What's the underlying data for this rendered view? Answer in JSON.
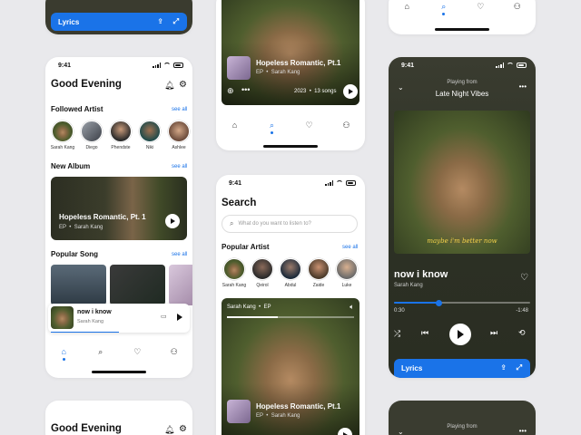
{
  "status_time": "9:41",
  "colors": {
    "accent": "#1a73e8",
    "dark_bg": "#2f3026",
    "page_bg": "#e9e9ec"
  },
  "home": {
    "title": "Good Evening",
    "followed_title": "Followed Artist",
    "see_all": "see all",
    "artists": [
      "Sarah Kang",
      "Diego",
      "Phendste",
      "Niki",
      "Ashlee"
    ],
    "new_album_title": "New Album",
    "album": {
      "title": "Hopeless Romantic, Pt. 1",
      "type": "EP",
      "artist": "Sarah Kang"
    },
    "popular_song_title": "Popular Song",
    "mini_player": {
      "title": "now i know",
      "artist": "Sarah Kang"
    }
  },
  "album_detail": {
    "title": "Hopeless Romantic, Pt.1",
    "type": "EP",
    "artist": "Sarah Kang",
    "year": "2023",
    "songs": "13 songs"
  },
  "search": {
    "title": "Search",
    "placeholder": "What do you want to listen to?",
    "popular_artist_title": "Popular Artist",
    "see_all": "see all",
    "artists": [
      "Sarah Kang",
      "Qeirol",
      "Abdul",
      "Zaide",
      "Luke"
    ],
    "card": {
      "artist": "Sarah Kang",
      "type": "EP",
      "title": "Hopeless Romantic, Pt.1"
    }
  },
  "player": {
    "playing_from": "Playing from",
    "playlist": "Late Night Vibes",
    "cover_caption": "maybe i'm better now",
    "song": "now i know",
    "artist": "Sarah Kang",
    "elapsed": "0:30",
    "remaining": "-1:48",
    "progress": 0.33,
    "lyrics_label": "Lyrics"
  },
  "top_left_lyrics": "Lyrics",
  "bottom_home_title": "Good Evening",
  "bottom_player_playing_from": "Playing from"
}
